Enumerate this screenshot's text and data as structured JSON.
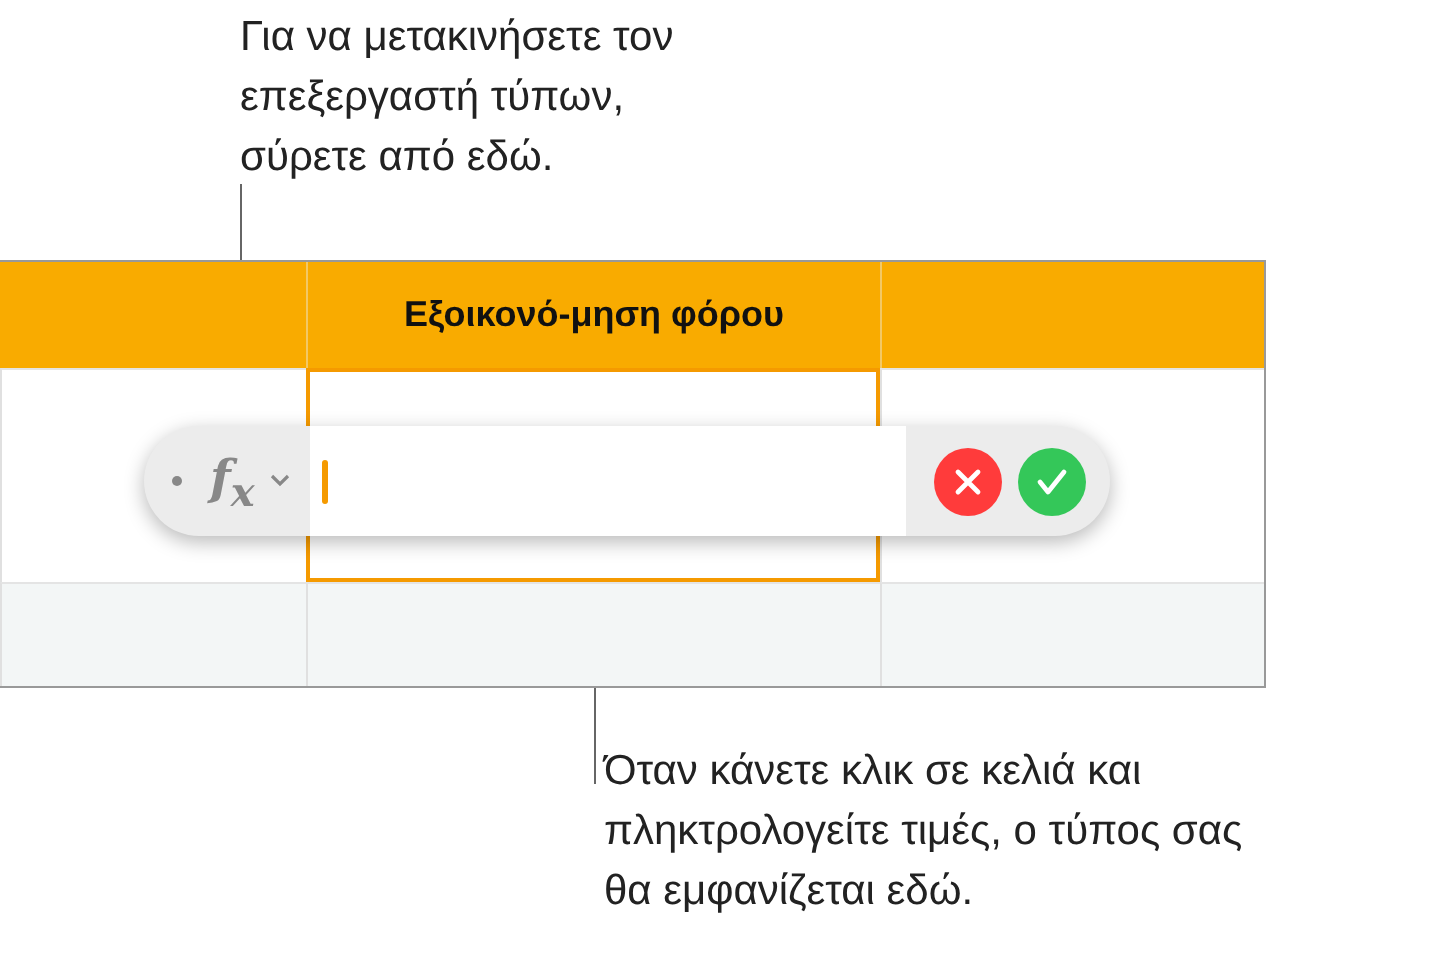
{
  "callouts": [
    {
      "kind": "top",
      "text": "Για να μετακινήσετε τον επεξεργαστή τύπων, σύρετε από εδώ."
    },
    {
      "kind": "bottom",
      "text": "Όταν κάνετε κλικ σε κελιά και πληκτρολογείτε τιμές, ο τύπος σας θα εμφανίζεται εδώ."
    }
  ],
  "table": {
    "header": [
      {
        "kind": "blank"
      },
      {
        "kind": "text",
        "label": "Εξοικονό-μηση φόρου"
      },
      {
        "kind": "blank"
      }
    ],
    "rows": [
      {
        "cells": [
          {
            "selected": false
          },
          {
            "selected": true
          },
          {
            "selected": false
          }
        ]
      },
      {
        "cells": [
          {
            "selected": false
          },
          {
            "selected": false
          },
          {
            "selected": false
          }
        ]
      }
    ]
  },
  "formula_editor": {
    "function_symbol": "f$_{x}$"
  }
}
